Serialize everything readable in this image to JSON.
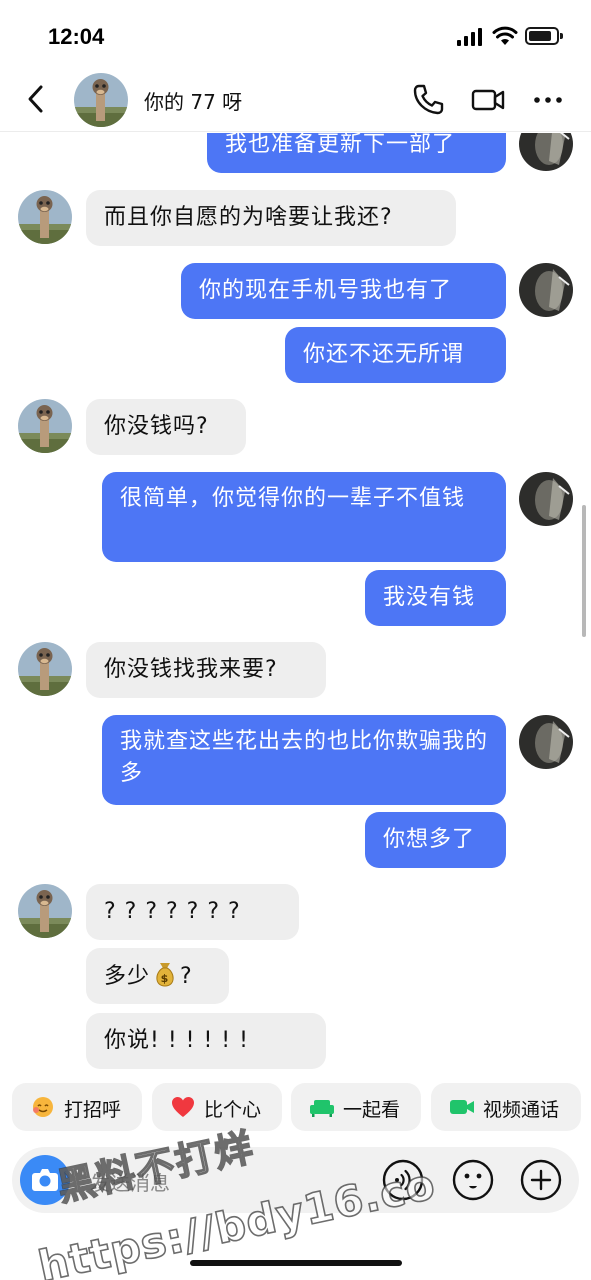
{
  "status": {
    "time": "12:04"
  },
  "header": {
    "contact_name": "你的 77 呀"
  },
  "messages": [
    {
      "side": "out",
      "text": "我也准备更新下一部了"
    },
    {
      "side": "in",
      "text": "而且你自愿的为啥要让我还?"
    },
    {
      "side": "out",
      "text": "你的现在手机号我也有了"
    },
    {
      "side": "out",
      "text": "你还不还无所谓"
    },
    {
      "side": "in",
      "text": "你没钱吗?"
    },
    {
      "side": "out",
      "text": "很简单，你觉得你的一辈子不值钱"
    },
    {
      "side": "out",
      "text": "我没有钱"
    },
    {
      "side": "in",
      "text": "你没钱找我来要?"
    },
    {
      "side": "out",
      "text": "我就查这些花出去的也比你欺骗我的多"
    },
    {
      "side": "out",
      "text": "你想多了"
    },
    {
      "side": "in",
      "text": "? ? ? ? ? ? ?"
    },
    {
      "side": "in",
      "text": "多少"
    },
    {
      "side": "in",
      "text": "你说! ! ! ! ! !"
    }
  ],
  "money_emoji_suffix": "?",
  "quick_replies": [
    {
      "label": "打招呼",
      "icon": "wave-face-icon"
    },
    {
      "label": "比个心",
      "icon": "heart-icon"
    },
    {
      "label": "一起看",
      "icon": "sofa-icon"
    },
    {
      "label": "视频通话",
      "icon": "video-camera-icon"
    }
  ],
  "input": {
    "placeholder": "发送消息"
  },
  "watermark": {
    "line1": "黑料不打烊",
    "line2": "https://bdy16.co"
  },
  "colors": {
    "outgoing_bubble": "#4d76f5",
    "incoming_bubble": "#eeeeee",
    "camera_button": "#3a8af6"
  }
}
